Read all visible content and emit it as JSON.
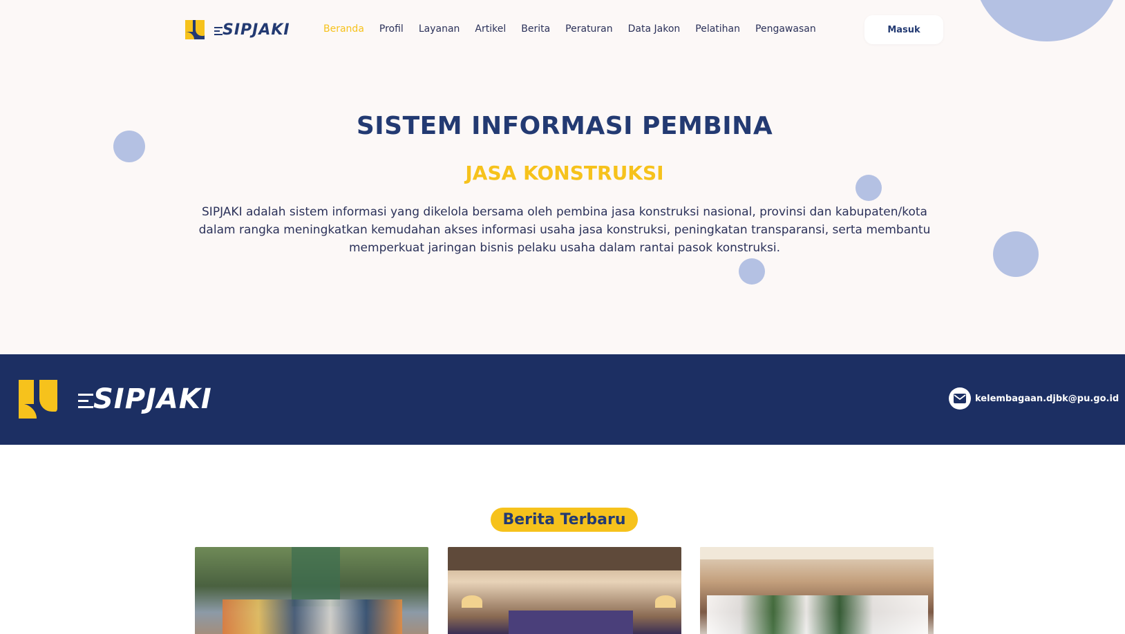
{
  "header": {
    "logo_text": "SIPJAKI",
    "nav": [
      {
        "label": "Beranda",
        "active": true
      },
      {
        "label": "Profil",
        "active": false
      },
      {
        "label": "Layanan",
        "active": false
      },
      {
        "label": "Artikel",
        "active": false
      },
      {
        "label": "Berita",
        "active": false
      },
      {
        "label": "Peraturan",
        "active": false
      },
      {
        "label": "Data Jakon",
        "active": false
      },
      {
        "label": "Pelatihan",
        "active": false
      },
      {
        "label": "Pengawasan",
        "active": false
      }
    ],
    "login_label": "Masuk"
  },
  "hero": {
    "title": "SISTEM INFORMASI PEMBINA",
    "subtitle": "JASA KONSTRUKSI",
    "description": "SIPJAKI adalah sistem informasi yang dikelola bersama oleh pembina jasa konstruksi nasional, provinsi dan kabupaten/kota dalam rangka meningkatkan kemudahan akses informasi usaha jasa konstruksi, peningkatan transparansi, serta membantu memperkuat jaringan bisnis pelaku usaha dalam rantai pasok konstruksi."
  },
  "band": {
    "logo_text": "SIPJAKI",
    "email": "kelembagaan.djbk@pu.go.id",
    "email_icon": "mail-icon"
  },
  "news": {
    "heading": "Berita Terbaru",
    "cards": [
      {
        "image": "news-photo-1"
      },
      {
        "image": "news-photo-2"
      },
      {
        "image": "news-photo-3"
      }
    ]
  },
  "colors": {
    "primary": "#233a72",
    "accent": "#f6c21c",
    "band": "#1c2f63",
    "hero_bg": "#fcf8f7",
    "bubble": "#b4c1e3"
  }
}
